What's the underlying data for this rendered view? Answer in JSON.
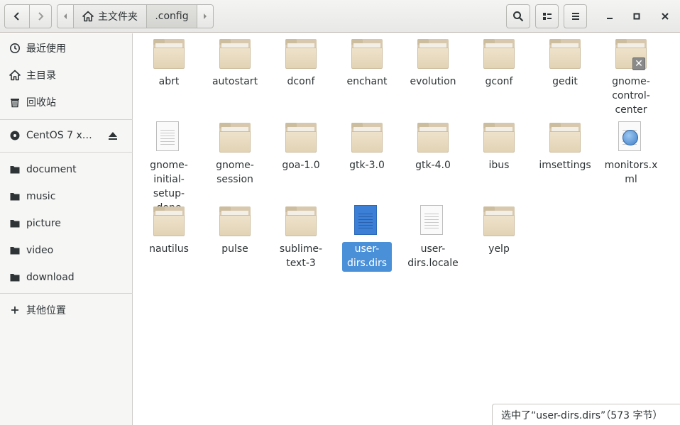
{
  "header": {
    "breadcrumb_home": "主文件夹",
    "breadcrumb_current": ".config"
  },
  "sidebar": {
    "items": [
      {
        "label": "最近使用",
        "icon": "clock-icon"
      },
      {
        "label": "主目录",
        "icon": "home-icon"
      },
      {
        "label": "回收站",
        "icon": "trash-icon"
      },
      {
        "label": "CentOS 7 x…",
        "icon": "disc-icon"
      },
      {
        "label": "document",
        "icon": "folder-icon"
      },
      {
        "label": "music",
        "icon": "folder-icon"
      },
      {
        "label": "picture",
        "icon": "folder-icon"
      },
      {
        "label": "video",
        "icon": "folder-icon"
      },
      {
        "label": "download",
        "icon": "folder-icon"
      },
      {
        "label": "其他位置",
        "icon": "plus-icon"
      }
    ]
  },
  "files": [
    {
      "name": "abrt",
      "type": "folder"
    },
    {
      "name": "autostart",
      "type": "folder"
    },
    {
      "name": "dconf",
      "type": "folder"
    },
    {
      "name": "enchant",
      "type": "folder"
    },
    {
      "name": "evolution",
      "type": "folder"
    },
    {
      "name": "gconf",
      "type": "folder"
    },
    {
      "name": "gedit",
      "type": "folder"
    },
    {
      "name": "gnome-control-center",
      "type": "folder-locked"
    },
    {
      "name": "gnome-initial-setup-done",
      "type": "text"
    },
    {
      "name": "gnome-session",
      "type": "folder"
    },
    {
      "name": "goa-1.0",
      "type": "folder"
    },
    {
      "name": "gtk-3.0",
      "type": "folder"
    },
    {
      "name": "gtk-4.0",
      "type": "folder"
    },
    {
      "name": "ibus",
      "type": "folder"
    },
    {
      "name": "imsettings",
      "type": "folder"
    },
    {
      "name": "monitors.xml",
      "type": "xml"
    },
    {
      "name": "nautilus",
      "type": "folder"
    },
    {
      "name": "pulse",
      "type": "folder"
    },
    {
      "name": "sublime-text-3",
      "type": "folder"
    },
    {
      "name": "user-dirs.dirs",
      "type": "text",
      "selected": true
    },
    {
      "name": "user-dirs.locale",
      "type": "text"
    },
    {
      "name": "yelp",
      "type": "folder"
    }
  ],
  "status": {
    "text": "选中了“user-dirs.dirs”（573 字节）"
  }
}
